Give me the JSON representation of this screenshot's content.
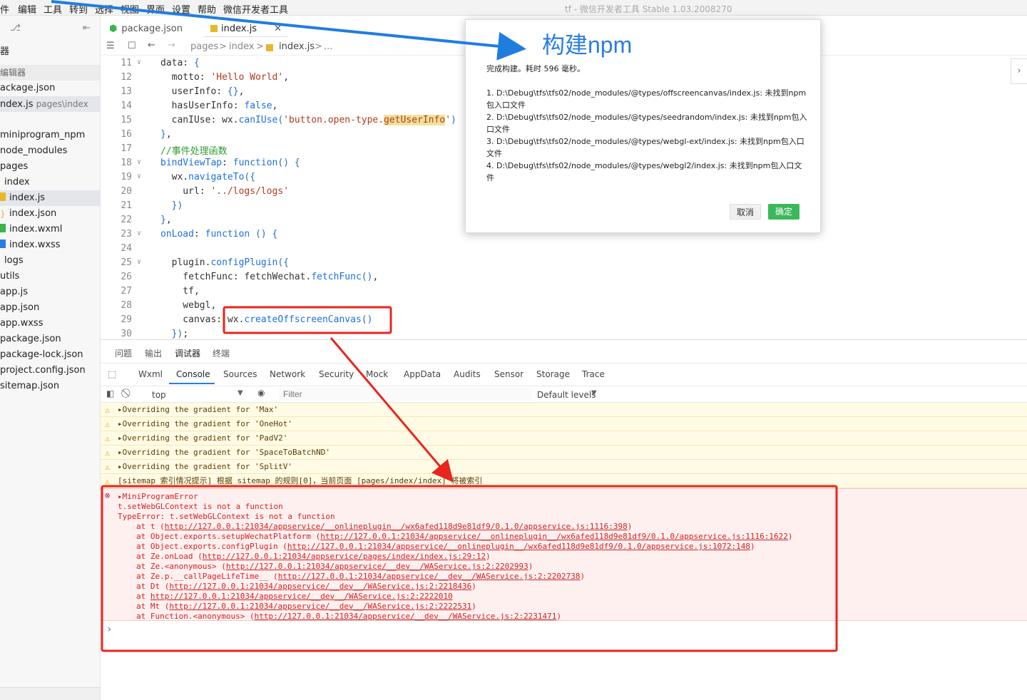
{
  "menu": [
    "件",
    "编辑",
    "工具",
    "转到",
    "选择",
    "视图",
    "界面",
    "设置",
    "帮助",
    "微信开发者工具"
  ],
  "window_title": "tf - 微信开发者工具 Stable 1.03.2008270",
  "sidebar": {
    "head": "器",
    "section": "编辑器",
    "open_files": [
      {
        "name": "ackage.json",
        "path": ""
      },
      {
        "name": "ndex.js",
        "path": "pages\\index"
      }
    ],
    "tree": [
      "miniprogram_npm",
      "node_modules",
      "pages",
      "index",
      "index.js",
      "index.json",
      "index.wxml",
      "index.wxss",
      "logs",
      "utils",
      "app.js",
      "app.json",
      "app.wxss",
      "package.json",
      "package-lock.json",
      "project.config.json",
      "sitemap.json"
    ]
  },
  "editor": {
    "tabs": [
      "package.json",
      "index.js"
    ],
    "breadcrumb": [
      "pages",
      "index",
      "index.js",
      "..."
    ],
    "line_numbers": [
      "11",
      "12",
      "13",
      "14",
      "15",
      "16",
      "17",
      "18",
      "19",
      "20",
      "21",
      "22",
      "23",
      "24",
      "25",
      "26",
      "27",
      "28",
      "29",
      "30"
    ]
  },
  "devtools": {
    "top_tabs": [
      "问题",
      "输出",
      "调试器",
      "终端"
    ],
    "console_tabs": [
      "Wxml",
      "Console",
      "Sources",
      "Network",
      "Security",
      "Mock",
      "AppData",
      "Audits",
      "Sensor",
      "Storage",
      "Trace"
    ],
    "context": "top",
    "filter_placeholder": "Filter",
    "levels": "Default levels",
    "warnings": [
      "Overriding the gradient for 'Max'",
      "Overriding the gradient for 'OneHot'",
      "Overriding the gradient for 'PadV2'",
      "Overriding the gradient for 'SpaceToBatchND'",
      "Overriding the gradient for 'SplitV'",
      "[sitemap 索引情况提示] 根据 sitemap 的规则[0]，当前页面 [pages/index/index] 将被索引"
    ],
    "error": {
      "title": "MiniProgramError",
      "line1": "t.setWebGLContext is not a function",
      "line2": "TypeError: t.setWebGLContext is not a function",
      "stack": [
        {
          "fn": "at t (",
          "url": "http://127.0.0.1:21034/appservice/__onlineplugin__/wx6afed118d9e81df9/0.1.0/appservice.js:1116:398",
          "end": ")"
        },
        {
          "fn": "at Object.exports.setupWechatPlatform (",
          "url": "http://127.0.0.1:21034/appservice/__onlineplugin__/wx6afed118d9e81df9/0.1.0/appservice.js:1116:1622",
          "end": ")"
        },
        {
          "fn": "at Object.exports.configPlugin (",
          "url": "http://127.0.0.1:21034/appservice/__onlineplugin__/wx6afed118d9e81df9/0.1.0/appservice.js:1072:148",
          "end": ")"
        },
        {
          "fn": "at Ze.onLoad (",
          "url": "http://127.0.0.1:21034/appservice/pages/index/index.js:29:12",
          "end": ")"
        },
        {
          "fn": "at Ze.<anonymous> (",
          "url": "http://127.0.0.1:21034/appservice/__dev__/WAService.js:2:2202993",
          "end": ")"
        },
        {
          "fn": "at Ze.p.__callPageLifeTime__ (",
          "url": "http://127.0.0.1:21034/appservice/__dev__/WAService.js:2:2202738",
          "end": ")"
        },
        {
          "fn": "at Dt (",
          "url": "http://127.0.0.1:21034/appservice/__dev__/WAService.js:2:2218436",
          "end": ")"
        },
        {
          "fn": "at ",
          "url": "http://127.0.0.1:21034/appservice/__dev__/WAService.js:2:2222010",
          "end": ""
        },
        {
          "fn": "at Mt (",
          "url": "http://127.0.0.1:21034/appservice/__dev__/WAService.js:2:2222531",
          "end": ")"
        },
        {
          "fn": "at Function.<anonymous> (",
          "url": "http://127.0.0.1:21034/appservice/__dev__/WAService.js:2:2231471",
          "end": ")"
        }
      ]
    },
    "prompt": "›"
  },
  "dialog": {
    "title": "构建npm",
    "summary": "完成构建。耗时 596 毫秒。",
    "lines": [
      "1. D:\\Debug\\tfs\\tfs02/node_modules/@types/offscreencanvas/index.js: 未找到npm",
      "包入口文件",
      "2. D:\\Debug\\tfs\\tfs02/node_modules/@types/seedrandom/index.js: 未找到npm包入",
      "口文件",
      "3. D:\\Debug\\tfs\\tfs02/node_modules/@types/webgl-ext/index.js: 未找到npm包入口",
      "文件",
      "4. D:\\Debug\\tfs\\tfs02/node_modules/@types/webgl2/index.js: 未找到npm包入口文",
      "件"
    ],
    "cancel": "取消",
    "ok": "确定"
  },
  "colors": {
    "accent": "#2a7de1",
    "ok_button": "#3cb85c",
    "error": "#d42222",
    "annotation": "#e8251f"
  }
}
